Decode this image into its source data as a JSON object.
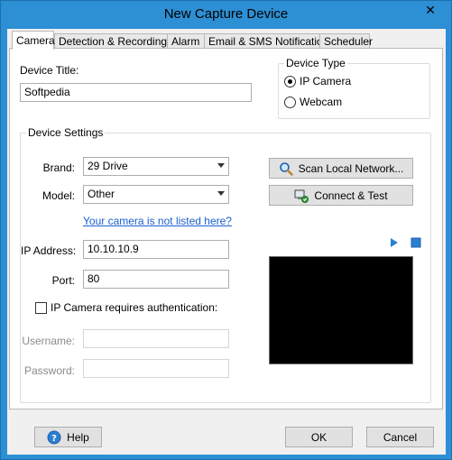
{
  "window": {
    "title": "New Capture Device",
    "close_glyph": "✕"
  },
  "tabs": [
    {
      "label": "Camera",
      "active": true
    },
    {
      "label": "Detection & Recording",
      "active": false
    },
    {
      "label": "Alarm",
      "active": false
    },
    {
      "label": "Email & SMS Notifications",
      "active": false
    },
    {
      "label": "Scheduler",
      "active": false
    }
  ],
  "device": {
    "title_label": "Device Title:",
    "title_value": "Softpedia"
  },
  "device_type": {
    "group_label": "Device Type",
    "options": [
      {
        "label": "IP Camera",
        "selected": true
      },
      {
        "label": "Webcam",
        "selected": false
      }
    ]
  },
  "settings": {
    "group_label": "Device Settings",
    "brand_label": "Brand:",
    "brand_value": "29 Drive",
    "model_label": "Model:",
    "model_value": "Other",
    "not_listed_link": "Your camera is not listed here?",
    "ip_label": "IP Address:",
    "ip_value": "10.10.10.9",
    "port_label": "Port:",
    "port_value": "80",
    "auth_label": "IP Camera requires authentication:",
    "auth_checked": false,
    "username_label": "Username:",
    "username_value": "",
    "password_label": "Password:",
    "password_value": ""
  },
  "actions": {
    "scan_label": "Scan Local Network...",
    "connect_label": "Connect & Test"
  },
  "footer": {
    "help_label": "Help",
    "ok_label": "OK",
    "cancel_label": "Cancel"
  },
  "icons": {
    "scan": "magnifier-icon",
    "connect": "network-test-icon",
    "play": "play-icon",
    "stop": "stop-icon",
    "help": "help-icon"
  },
  "colors": {
    "titlebar": "#2d8fd4",
    "link": "#1a5fd0",
    "play_stop": "#2b7fd0",
    "preview_bg": "#000000"
  }
}
